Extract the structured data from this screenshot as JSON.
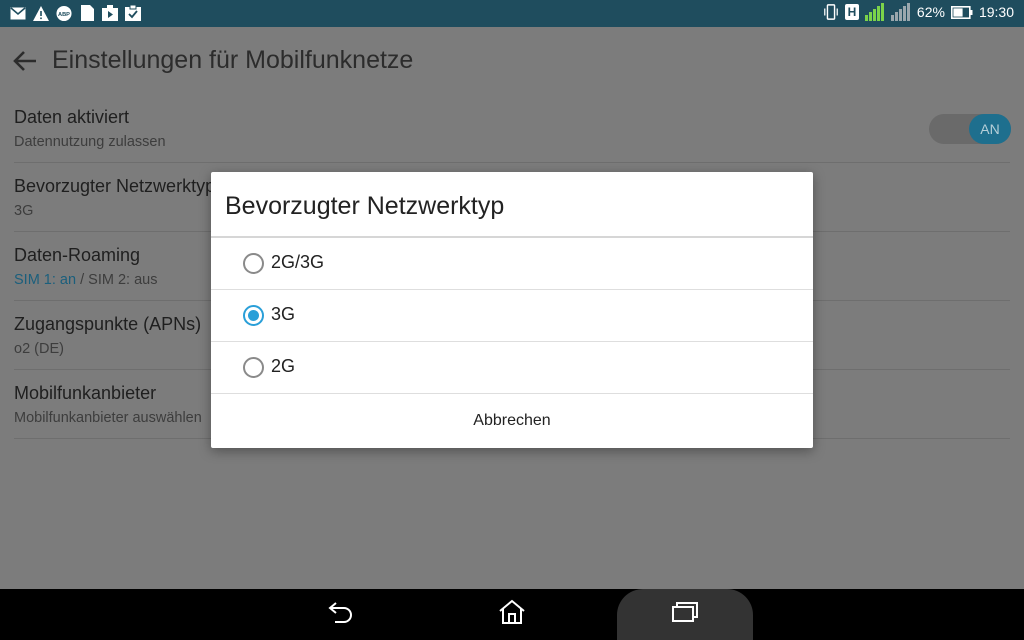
{
  "status_bar": {
    "left_icons": [
      "mail-icon",
      "warning-icon",
      "adblock-icon",
      "file-icon",
      "media-icon",
      "clipboard-icon"
    ],
    "adblock_text": "ABP",
    "network_badge": "H",
    "battery_percent": "62%",
    "battery_level": 0.62,
    "time": "19:30"
  },
  "app": {
    "title": "Einstellungen für Mobilfunknetze"
  },
  "settings": [
    {
      "title": "Daten aktiviert",
      "summary": "Datennutzung zulassen"
    },
    {
      "title": "Bevorzugter Netzwerktyp",
      "summary": "3G"
    },
    {
      "title": "Daten-Roaming",
      "summary_accent": "SIM 1: an",
      "summary_rest": " / SIM 2: aus"
    },
    {
      "title": "Zugangspunkte (APNs)",
      "summary": "o2 (DE)"
    },
    {
      "title": "Mobilfunkanbieter",
      "summary": "Mobilfunkanbieter auswählen"
    }
  ],
  "data_toggle": {
    "label": "AN",
    "on": true
  },
  "dialog": {
    "title": "Bevorzugter Netzwerktyp",
    "options": [
      {
        "label": "2G/3G",
        "selected": false
      },
      {
        "label": "3G",
        "selected": true
      },
      {
        "label": "2G",
        "selected": false
      }
    ],
    "cancel_label": "Abbrechen"
  },
  "colors": {
    "status_bar": "#1f4d5e",
    "accent": "#2a9fd8",
    "scrim": "#7c7c7c"
  }
}
